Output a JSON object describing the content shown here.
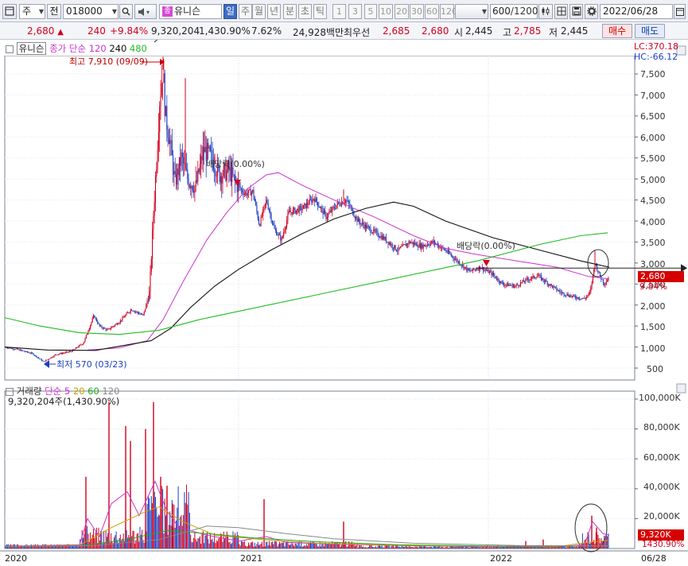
{
  "toolbar": {
    "type_label": "주",
    "prev_label": "전",
    "code": "018000",
    "stock_name": "유니슨",
    "period_tabs": [
      "일",
      "주",
      "월",
      "년",
      "분",
      "초",
      "틱"
    ],
    "selected_period": "일",
    "minute_options": [
      "1",
      "3",
      "5",
      "10",
      "20",
      "30",
      "60",
      "120"
    ],
    "count": "600",
    "count_total": "/1200",
    "date": "2022/06/28"
  },
  "quote": {
    "price": "2,680",
    "arrow": "▲",
    "change": "240",
    "change_pct": "+9.84%",
    "volume": "9,320,204",
    "volume_ratio": "1,430.90%",
    "turnover": "7.62%",
    "amount": "24,928백만",
    "best_ask_label": "최우선",
    "best_ask": "2,685",
    "best_bid": "2,680",
    "open_label": "시",
    "open": "2,445",
    "high_label": "고",
    "high": "2,785",
    "low_label": "저",
    "low": "2,445",
    "buy_label": "매수",
    "sell_label": "매도"
  },
  "price_panel": {
    "name": "유니슨",
    "ma_legend_prefix": "종가 단순",
    "ma_periods": [
      "120",
      "240",
      "480"
    ],
    "ma_colors": [
      "#cc33cc",
      "#111111",
      "#22bb22"
    ],
    "lc": "LC:370.18",
    "hc": "HC:-66.12",
    "high_note": "최고 7,910 (09/09)",
    "low_note": "최저 570 (03/23)",
    "dividend_note": "배당락(0.00%)",
    "current_price": "2,680",
    "current_pct": "9.84%",
    "y_ticks": [
      "7,500",
      "7,000",
      "6,500",
      "6,000",
      "5,500",
      "5,000",
      "4,500",
      "4,000",
      "3,500",
      "3,000",
      "2,500",
      "2,000",
      "1,500",
      "1,000",
      "500"
    ]
  },
  "volume_panel": {
    "title": "거래량",
    "ma_prefix": "단순",
    "ma_periods": [
      "5",
      "20",
      "60",
      "120"
    ],
    "ma_colors": [
      "#cc33cc",
      "#c8a000",
      "#22aa22",
      "#888888"
    ],
    "summary": "9,320,204주(1,430.90%)",
    "y_ticks": [
      "100,000K",
      "80,000K",
      "60,000K",
      "40,000K",
      "20,000K"
    ],
    "current_volume": "9,320K",
    "current_pct": "1430.90%"
  },
  "x_axis": {
    "labels": [
      "2020",
      "2021",
      "2022"
    ],
    "end_label": "06/28"
  },
  "colors": {
    "up": "#d2001f",
    "down": "#1a3fc2",
    "price_bg": "#d60000"
  }
}
